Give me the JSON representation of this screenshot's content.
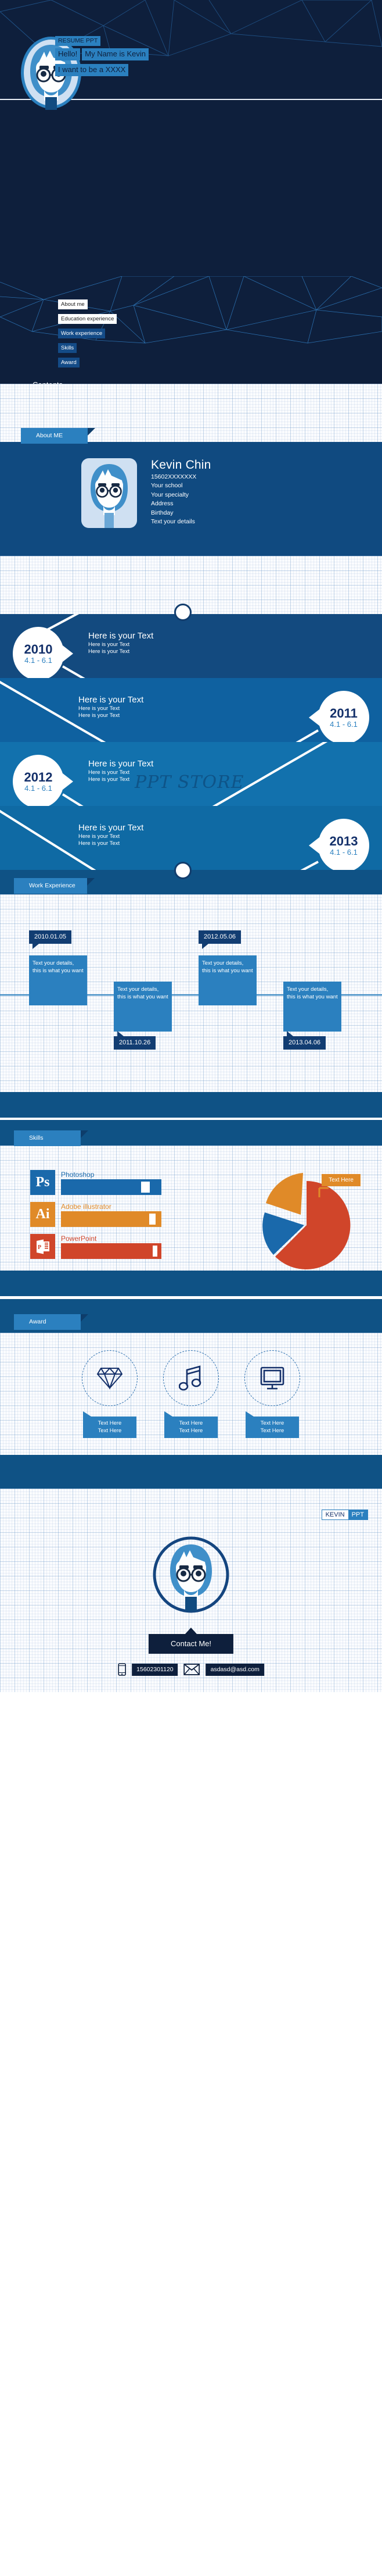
{
  "cover": {
    "kicker": "RESUME PPT",
    "greeting": "Hello!",
    "name_line": "My Name is Kevin",
    "goal_line": "I want to be a XXXX",
    "avatar_icon": "avatar-boy-glasses-icon"
  },
  "contents": {
    "label": "Contents",
    "items": [
      {
        "label": "About me",
        "style": "light"
      },
      {
        "label": "Education experience",
        "style": "light"
      },
      {
        "label": "Work experience",
        "style": "dark"
      },
      {
        "label": "Skills",
        "style": "dark"
      },
      {
        "label": "Award",
        "style": "dark"
      }
    ]
  },
  "about": {
    "ribbon": "About ME",
    "name": "Kevin Chin",
    "details": [
      "15602XXXXXXX",
      "Your school",
      "Your specialty",
      "Address",
      "Birthday",
      "Text your details"
    ]
  },
  "timeline": {
    "watermark": "PPT STORE",
    "entries": [
      {
        "year": "2010",
        "range": "4.1 - 6.1",
        "side": "left",
        "heading": "Here is your  Text",
        "sub1": "Here is your  Text",
        "sub2": "Here is your  Text"
      },
      {
        "year": "2011",
        "range": "4.1 - 6.1",
        "side": "right",
        "heading": "Here is your  Text",
        "sub1": "Here is your  Text",
        "sub2": "Here is your  Text"
      },
      {
        "year": "2012",
        "range": "4.1 - 6.1",
        "side": "left",
        "heading": "Here is your  Text",
        "sub1": "Here is your  Text",
        "sub2": "Here is your  Text"
      },
      {
        "year": "2013",
        "range": "4.1 - 6.1",
        "side": "right",
        "heading": "Here is your  Text",
        "sub1": "Here is your  Text",
        "sub2": "Here is your  Text"
      }
    ]
  },
  "work": {
    "ribbon": "Work Experience",
    "items": [
      {
        "date": "2010.01.05",
        "position": "top",
        "body": "Text your details, this is what you want"
      },
      {
        "date": "2011.10.26",
        "position": "bottom",
        "body": "Text your details, this is what you want"
      },
      {
        "date": "2012.05.06",
        "position": "top",
        "body": "Text your details, this is what you want"
      },
      {
        "date": "2013.04.06",
        "position": "bottom",
        "body": "Text your details, this is what you want"
      }
    ]
  },
  "skills": {
    "ribbon": "Skills",
    "bars": [
      {
        "icon_label": "Ps",
        "icon_name": "photoshop-icon",
        "name": "Photoshop",
        "color": "#1a69ab",
        "percent": 82
      },
      {
        "icon_label": "Ai",
        "icon_name": "illustrator-icon",
        "name": "Adobe illustrator",
        "color": "#e08a28",
        "percent": 91
      },
      {
        "icon_label": "P",
        "icon_name": "powerpoint-icon",
        "name": "PowerPoint",
        "color": "#d0452a",
        "percent": 94
      }
    ],
    "pie_label": "Text Here"
  },
  "award": {
    "ribbon": "Award",
    "items": [
      {
        "icon": "diamond-icon",
        "line1": "Text Here",
        "line2": "Text Here"
      },
      {
        "icon": "music-note-icon",
        "line1": "Text Here",
        "line2": "Text Here"
      },
      {
        "icon": "monitor-icon",
        "line1": "Text Here",
        "line2": "Text Here"
      }
    ]
  },
  "end": {
    "brand_left": "KEVIN",
    "brand_right": "PPT",
    "contact_button": "Contact Me!",
    "phone": "15602301120",
    "email": "asdasd@asd.com",
    "avatar_icon": "avatar-boy-glasses-icon"
  },
  "chart_data": {
    "type": "pie",
    "title": "",
    "labels": [
      "PowerPoint",
      "Photoshop",
      "Adobe illustrator"
    ],
    "values": [
      62,
      22,
      16
    ],
    "colors": [
      "#d0452a",
      "#1a69ab",
      "#e08a28"
    ],
    "annotations": [
      "Text Here"
    ],
    "legend": "none",
    "exploded_slice": "Adobe illustrator"
  }
}
